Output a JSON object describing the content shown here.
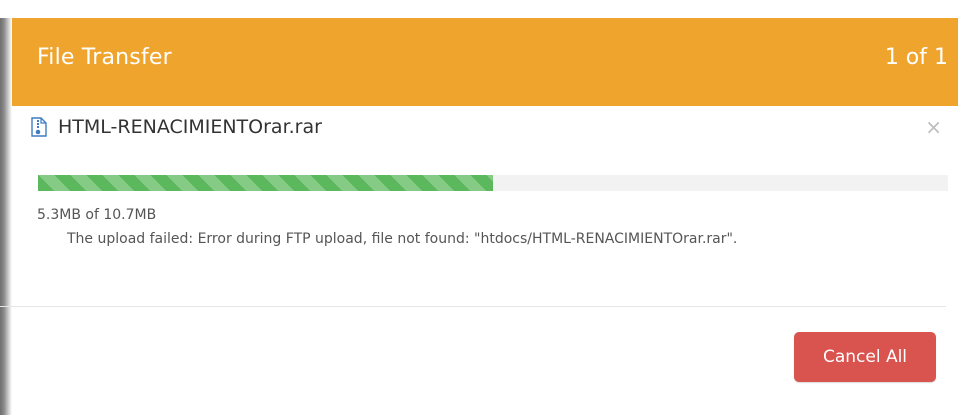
{
  "dialog": {
    "title": "File Transfer",
    "counter": "1 of 1",
    "header_color": "#efa52d"
  },
  "transfer": {
    "file_icon": "archive-file-icon",
    "file_name": "HTML-RENACIMIENTOrar.rar",
    "close_symbol": "×",
    "progress_fraction": 0.5,
    "progress_color": "#5cb85c",
    "size_text": "5.3MB of 10.7MB",
    "error_message": "The upload failed: Error during FTP upload, file not found: \"htdocs/HTML-RENACIMIENTOrar.rar\"."
  },
  "footer": {
    "cancel_all_label": "Cancel All",
    "cancel_color": "#d9534f"
  }
}
